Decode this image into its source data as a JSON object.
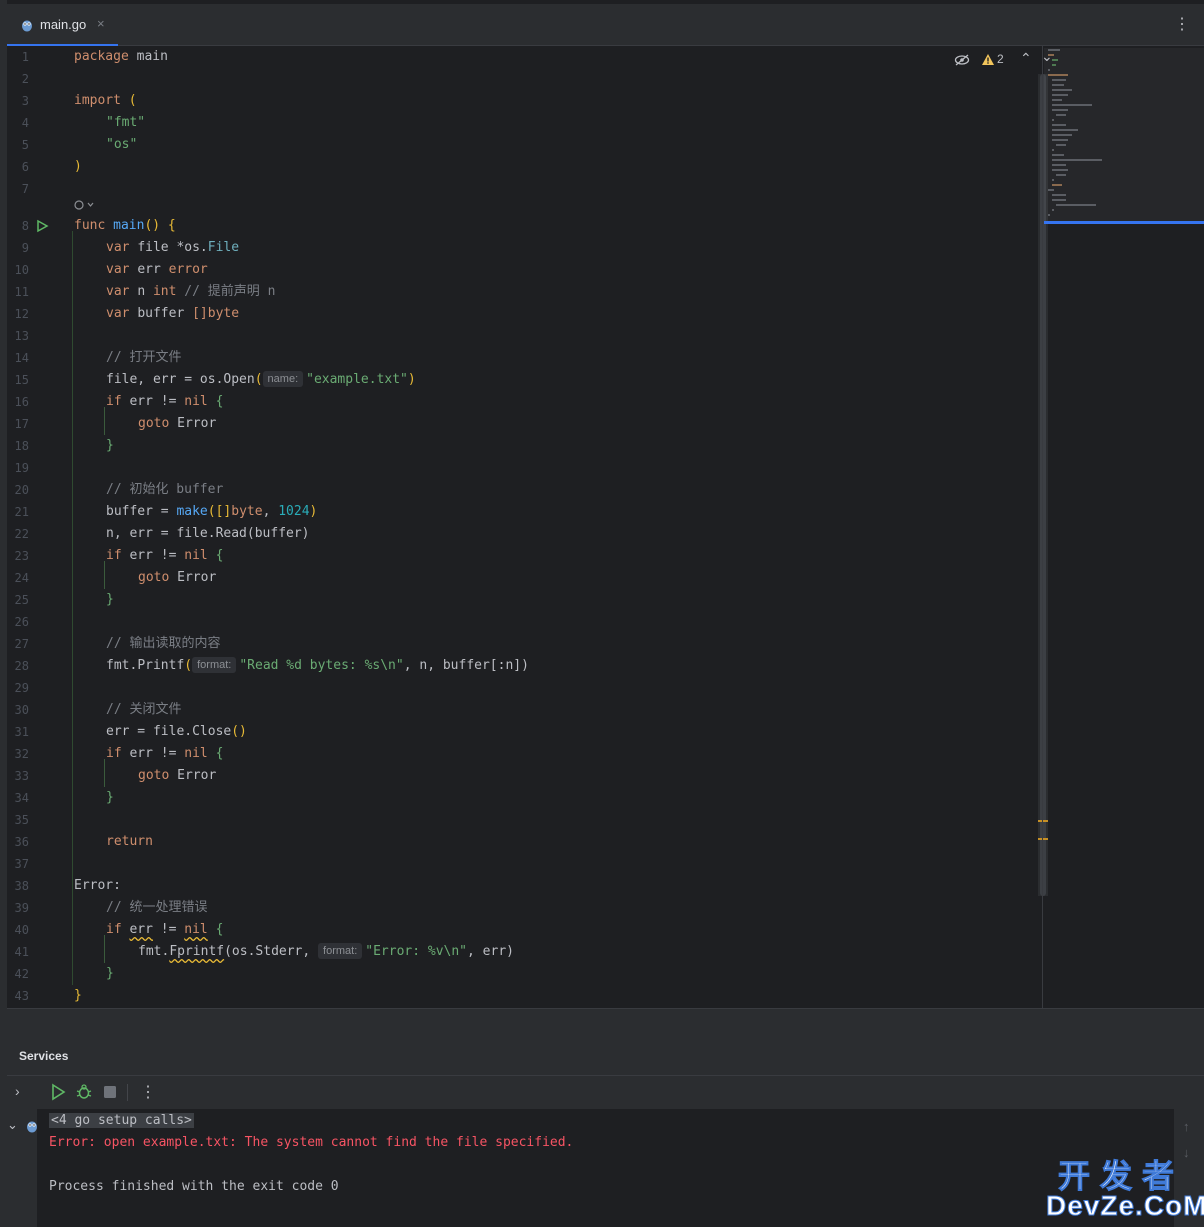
{
  "tab": {
    "filename": "main.go",
    "close": "×",
    "menu": "⋮"
  },
  "inspection": {
    "warnings": "2",
    "up": "⌃",
    "down": "⌄"
  },
  "gutter": {
    "lines": [
      "1",
      "2",
      "3",
      "4",
      "5",
      "6",
      "7",
      "8",
      "9",
      "10",
      "11",
      "12",
      "13",
      "14",
      "15",
      "16",
      "17",
      "18",
      "19",
      "20",
      "21",
      "22",
      "23",
      "24",
      "25",
      "26",
      "27",
      "28",
      "29",
      "30",
      "31",
      "32",
      "33",
      "34",
      "35",
      "36",
      "37",
      "38",
      "39",
      "40",
      "41",
      "42",
      "43"
    ]
  },
  "code": {
    "l1": {
      "kw": "package",
      "name": "main"
    },
    "l3": {
      "kw": "import",
      "paren": "("
    },
    "l4": "\"fmt\"",
    "l5": "\"os\"",
    "l6": ")",
    "l8": {
      "kw": "func",
      "name": "main",
      "rest": "() {"
    },
    "l9": {
      "kw": "var",
      "rest": "file *os.",
      "type": "File"
    },
    "l10": {
      "kw": "var",
      "rest": "err",
      "type": "error"
    },
    "l11": {
      "kw": "var",
      "rest": "n",
      "type": "int",
      "comment": "// 提前声明 n"
    },
    "l12": {
      "kw": "var",
      "rest": "buffer",
      "type": "[]byte"
    },
    "l14": "// 打开文件",
    "l15": {
      "a": "file, err = os.",
      "fn": "Open",
      "hint": "name:",
      "str": "\"example.txt\"",
      "close": ")"
    },
    "l16": {
      "kw": "if",
      "a": "err != ",
      "nil": "nil",
      "b": "{"
    },
    "l17": {
      "kw": "goto",
      "label": "Error"
    },
    "l18": "}",
    "l20": "// 初始化 buffer",
    "l21": {
      "a": "buffer = ",
      "fn": "make",
      "b": "([]",
      "type": "byte",
      "c": ", ",
      "num": "1024",
      "d": ")"
    },
    "l22": {
      "a": "n, err = file.",
      "fn": "Read",
      "b": "(buffer)"
    },
    "l23": {
      "kw": "if",
      "a": "err != ",
      "nil": "nil",
      "b": "{"
    },
    "l24": {
      "kw": "goto",
      "label": "Error"
    },
    "l25": "}",
    "l27": "// 输出读取的内容",
    "l28": {
      "a": "fmt.",
      "fn": "Printf",
      "hint": "format:",
      "str": "\"Read %d bytes: %s\\n\"",
      "b": ", n, buffer[:n])"
    },
    "l30": "// 关闭文件",
    "l31": {
      "a": "err = file.",
      "fn": "Close",
      "b": "()"
    },
    "l32": {
      "kw": "if",
      "a": "err != ",
      "nil": "nil",
      "b": "{"
    },
    "l33": {
      "kw": "goto",
      "label": "Error"
    },
    "l34": "}",
    "l36": {
      "kw": "return"
    },
    "l38": "Error:",
    "l39": "// 统一处理错误",
    "l40": {
      "kw": "if",
      "err": "err",
      "a": " != ",
      "nil": "nil",
      "b": " {"
    },
    "l41": {
      "a": "fmt.",
      "fn": "Fprintf",
      "b": "(os.Stderr, ",
      "hint": "format:",
      "str": "\"Error: %v\\n\"",
      "c": ", err)"
    },
    "l42": "}",
    "l43": "}"
  },
  "services": {
    "title": "Services",
    "console": {
      "setup_calls": "<4 go setup calls>",
      "error_line": "Error: open example.txt: The system cannot find the file specified.",
      "finish_line": "Process finished with the exit code 0"
    }
  },
  "watermark": {
    "top": "开发者",
    "bottom": "DevZe.CoM"
  },
  "colors": {
    "accent": "#3574f0",
    "error": "#f75464",
    "keyword": "#cf8e6d",
    "string": "#6aab73",
    "function": "#56a8f5"
  }
}
